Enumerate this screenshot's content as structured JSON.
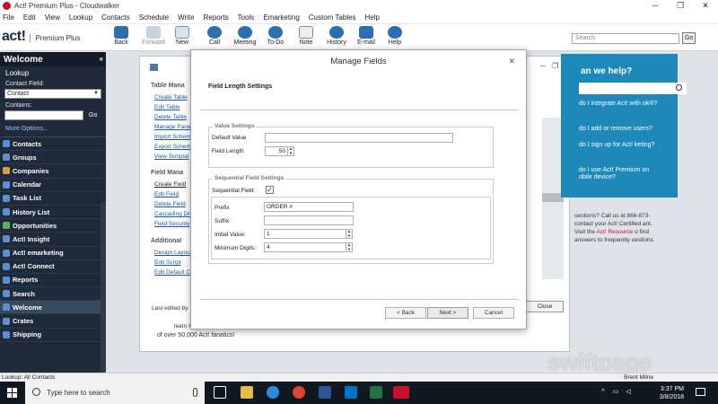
{
  "window": {
    "title": "Act! Premium Plus - Cloudwalker"
  },
  "menu": [
    "File",
    "Edit",
    "View",
    "Lookup",
    "Contacts",
    "Schedule",
    "Write",
    "Reports",
    "Tools",
    "Emarketing",
    "Custom Tables",
    "Help"
  ],
  "brand": {
    "logo": "act!",
    "product": "Premium Plus"
  },
  "toolbar": {
    "buttons": [
      "Back",
      "Forward",
      "New",
      "Call",
      "Meeting",
      "To-Do",
      "Note",
      "History",
      "E-mail",
      "Help"
    ],
    "search_placeholder": "Search",
    "go": "Go"
  },
  "sidebar": {
    "title": "Welcome",
    "lookup_label": "Lookup",
    "contact_field_label": "Contact Field:",
    "contact_field_value": "Contact",
    "contains_label": "Contains:",
    "go": "Go",
    "more_options": "More Options...",
    "items": [
      "Contacts",
      "Groups",
      "Companies",
      "Calendar",
      "Task List",
      "History List",
      "Opportunities",
      "Act! Insight",
      "Act! emarketing",
      "Act! Connect",
      "Reports",
      "Search",
      "Welcome",
      "Crates",
      "Shipping"
    ],
    "active": "Welcome"
  },
  "background": {
    "sections": [
      {
        "title": "Table Mana",
        "links": [
          "Create Table",
          "Edit Table",
          "Delete Table",
          "Manage Paren",
          "Import Schem",
          "Export Schem",
          "View Templat"
        ]
      },
      {
        "title": "Field Mana",
        "links": [
          "Create Field",
          "Edit Field",
          "Delete Field",
          "Cascading Dro",
          "Field Security"
        ]
      },
      {
        "title": "Additional",
        "links": [
          "Design Layout",
          "Edit Script",
          "Edit Default C"
        ]
      }
    ],
    "last_edited": "Last edited by",
    "close": "Close",
    "learn_how": "learn how t",
    "fanatics": "of over 50,000 Act! fanatics!"
  },
  "help_panel": {
    "title": "an we help?",
    "questions": [
      "do I integrate Act! with ok®?",
      "do I add or remove users?",
      "do I sign up for Act! keting?",
      "do I use Act! Premium on obile device?"
    ],
    "lower_text": "uestions? Call us at 866-873- contact your Act! Certified ant. Visit the",
    "lower_link": "Act! Resource",
    "lower_tail": "o find answers to frequently uestions."
  },
  "dialog": {
    "title": "Manage Fields",
    "heading": "Field Length Settings",
    "value_settings": "Value Settings",
    "default_value_label": "Default Value",
    "default_value": "",
    "field_length_label": "Field Length",
    "field_length": "50",
    "sequential_settings": "Sequential Field Settings",
    "sequential_field_label": "Sequential Field",
    "sequential_checked": true,
    "prefix_label": "Prefix",
    "prefix": "ORDER #",
    "suffix_label": "Suffix:",
    "suffix": "",
    "initial_label": "Initial Value:",
    "initial": "1",
    "min_digits_label": "Minimum Digits:",
    "min_digits": "4",
    "back": "< Back",
    "next": "Next >",
    "cancel": "Cancel"
  },
  "statusbar": {
    "lookup": "Lookup: All Contacts",
    "user": "Brent Milne"
  },
  "taskbar": {
    "search": "Type here to search",
    "time": "3:37 PM",
    "date": "3/8/2018"
  },
  "watermark": "swiftpage"
}
